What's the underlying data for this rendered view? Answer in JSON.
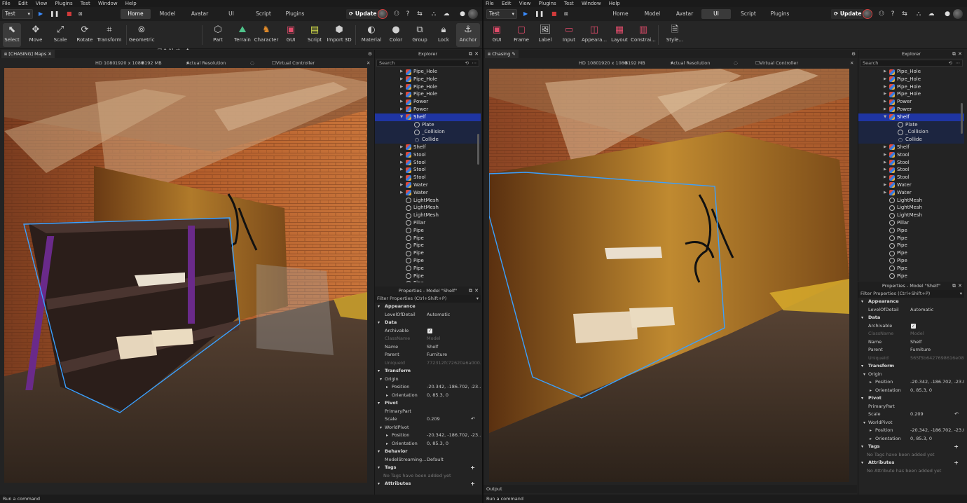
{
  "left": {
    "menu": [
      "File",
      "Edit",
      "View",
      "Plugins",
      "Test",
      "Window",
      "Help"
    ],
    "mode_dropdown": "Test",
    "tabs": [
      "Home",
      "Model",
      "Avatar",
      "UI",
      "Script",
      "Plugins"
    ],
    "active_tab": "Home",
    "update_label": "Update",
    "tools": [
      {
        "label": "Select",
        "icon": "cursor-icon"
      },
      {
        "label": "Move",
        "icon": "move-icon"
      },
      {
        "label": "Scale",
        "icon": "scale-icon"
      },
      {
        "label": "Rotate",
        "icon": "rotate-icon"
      },
      {
        "label": "Transform",
        "icon": "transform-icon"
      },
      {
        "label": "Geometric",
        "icon": "geometric-icon"
      },
      {
        "label": "Part",
        "icon": "cube-icon"
      },
      {
        "label": "Terrain",
        "icon": "terrain-icon"
      },
      {
        "label": "Character",
        "icon": "character-icon"
      },
      {
        "label": "GUI",
        "icon": "gui-icon"
      },
      {
        "label": "Script",
        "icon": "script-icon"
      },
      {
        "label": "Import 3D",
        "icon": "import-icon"
      },
      {
        "label": "Material",
        "icon": "material-icon"
      },
      {
        "label": "Color",
        "icon": "color-icon"
      },
      {
        "label": "Group",
        "icon": "group-icon"
      },
      {
        "label": "Lock",
        "icon": "lock-icon"
      },
      {
        "label": "Anchor",
        "icon": "anchor-icon"
      }
    ],
    "snap_move": "01 st...",
    "snap_rotate": "1°",
    "doc_tab": "[CHASING] Maps",
    "viewport_bar": {
      "preset": "HD 1080",
      "resolution": "1920 x 1080",
      "memory": "8192 MB",
      "mode": "Actual Resolution",
      "virtual": "Virtual Controller"
    },
    "command_placeholder": "Run a command"
  },
  "right": {
    "menu": [
      "File",
      "Edit",
      "View",
      "Plugins",
      "Test",
      "Window",
      "Help"
    ],
    "mode_dropdown": "Test",
    "tabs": [
      "Home",
      "Model",
      "Avatar",
      "UI",
      "Script",
      "Plugins"
    ],
    "active_tab": "UI",
    "update_label": "Update",
    "tools": [
      {
        "label": "GUI",
        "icon": "gui-icon"
      },
      {
        "label": "Frame",
        "icon": "frame-icon"
      },
      {
        "label": "Label",
        "icon": "label-icon"
      },
      {
        "label": "Input",
        "icon": "input-icon"
      },
      {
        "label": "Appeara...",
        "icon": "appearance-icon"
      },
      {
        "label": "Layout",
        "icon": "layout-icon"
      },
      {
        "label": "Constrai...",
        "icon": "constraint-icon"
      },
      {
        "label": "Style...",
        "icon": "style-icon"
      }
    ],
    "doc_tab": "Chasing",
    "viewport_bar": {
      "preset": "HD 1080",
      "resolution": "1920 x 1080",
      "memory": "8192 MB",
      "mode": "Actual Resolution",
      "virtual": "Virtual Controller"
    },
    "output_label": "Output",
    "command_placeholder": "Run a command"
  },
  "explorer": {
    "title": "Explorer",
    "search_placeholder": "Search",
    "items_left": [
      {
        "label": "Pipe_Hole",
        "type": "model",
        "depth": 0
      },
      {
        "label": "Pipe_Hole",
        "type": "model",
        "depth": 0
      },
      {
        "label": "Pipe_Hole",
        "type": "model",
        "depth": 0
      },
      {
        "label": "Pipe_Hole",
        "type": "model",
        "depth": 0
      },
      {
        "label": "Power",
        "type": "model",
        "depth": 0
      },
      {
        "label": "Power",
        "type": "model",
        "depth": 0
      },
      {
        "label": "Shelf",
        "type": "model",
        "depth": 0,
        "selected": true,
        "expanded": true
      },
      {
        "label": "Plate",
        "type": "mesh",
        "depth": 1
      },
      {
        "label": "_Collision",
        "type": "mesh",
        "depth": 1
      },
      {
        "label": "Collide",
        "type": "part",
        "depth": 1
      },
      {
        "label": "Shelf",
        "type": "model",
        "depth": 0
      },
      {
        "label": "Stool",
        "type": "model",
        "depth": 0
      },
      {
        "label": "Stool",
        "type": "model",
        "depth": 0
      },
      {
        "label": "Stool",
        "type": "model",
        "depth": 0
      },
      {
        "label": "Stool",
        "type": "model",
        "depth": 0
      },
      {
        "label": "Water",
        "type": "model",
        "depth": 0
      },
      {
        "label": "Water",
        "type": "model",
        "depth": 0
      },
      {
        "label": "LightMesh",
        "type": "mesh",
        "depth": 0
      },
      {
        "label": "LightMesh",
        "type": "mesh",
        "depth": 0
      },
      {
        "label": "LightMesh",
        "type": "mesh",
        "depth": 0
      },
      {
        "label": "Pillar",
        "type": "mesh",
        "depth": 0
      },
      {
        "label": "Pipe",
        "type": "mesh",
        "depth": 0
      },
      {
        "label": "Pipe",
        "type": "mesh",
        "depth": 0
      },
      {
        "label": "Pipe",
        "type": "mesh",
        "depth": 0
      },
      {
        "label": "Pipe",
        "type": "mesh",
        "depth": 0
      },
      {
        "label": "Pipe",
        "type": "mesh",
        "depth": 0
      },
      {
        "label": "Pipe",
        "type": "mesh",
        "depth": 0
      },
      {
        "label": "Pipe",
        "type": "mesh",
        "depth": 0
      },
      {
        "label": "Pipe",
        "type": "mesh",
        "depth": 0
      }
    ],
    "items_right": [
      {
        "label": "Pipe_Hole",
        "type": "model",
        "depth": 0
      },
      {
        "label": "Pipe_Hole",
        "type": "model",
        "depth": 0
      },
      {
        "label": "Pipe_Hole",
        "type": "model",
        "depth": 0
      },
      {
        "label": "Pipe_Hole",
        "type": "model",
        "depth": 0
      },
      {
        "label": "Power",
        "type": "model",
        "depth": 0
      },
      {
        "label": "Power",
        "type": "model",
        "depth": 0
      },
      {
        "label": "Shelf",
        "type": "model",
        "depth": 0,
        "selected": true,
        "expanded": true
      },
      {
        "label": "Plate",
        "type": "mesh",
        "depth": 1
      },
      {
        "label": "_Collision",
        "type": "mesh",
        "depth": 1
      },
      {
        "label": "Collide",
        "type": "part",
        "depth": 1
      },
      {
        "label": "Shelf",
        "type": "model",
        "depth": 0
      },
      {
        "label": "Stool",
        "type": "model",
        "depth": 0
      },
      {
        "label": "Stool",
        "type": "model",
        "depth": 0
      },
      {
        "label": "Stool",
        "type": "model",
        "depth": 0
      },
      {
        "label": "Stool",
        "type": "model",
        "depth": 0
      },
      {
        "label": "Water",
        "type": "model",
        "depth": 0
      },
      {
        "label": "Water",
        "type": "model",
        "depth": 0
      },
      {
        "label": "LightMesh",
        "type": "mesh",
        "depth": 0
      },
      {
        "label": "LightMesh",
        "type": "mesh",
        "depth": 0
      },
      {
        "label": "LightMesh",
        "type": "mesh",
        "depth": 0
      },
      {
        "label": "Pillar",
        "type": "mesh",
        "depth": 0
      },
      {
        "label": "Pipe",
        "type": "mesh",
        "depth": 0
      },
      {
        "label": "Pipe",
        "type": "mesh",
        "depth": 0
      },
      {
        "label": "Pipe",
        "type": "mesh",
        "depth": 0
      },
      {
        "label": "Pipe",
        "type": "mesh",
        "depth": 0
      },
      {
        "label": "Pipe",
        "type": "mesh",
        "depth": 0
      },
      {
        "label": "Pipe",
        "type": "mesh",
        "depth": 0
      },
      {
        "label": "Pipe",
        "type": "mesh",
        "depth": 0
      }
    ]
  },
  "properties": {
    "title": "Properties - Model \"Shelf\"",
    "filter_placeholder": "Filter Properties (Ctrl+Shift+P)",
    "rows_left": [
      {
        "kind": "cat",
        "label": "Appearance"
      },
      {
        "kind": "prop",
        "label": "LevelOfDetail",
        "value": "Automatic"
      },
      {
        "kind": "cat",
        "label": "Data"
      },
      {
        "kind": "check",
        "label": "Archivable",
        "value": "✓"
      },
      {
        "kind": "prop",
        "label": "ClassName",
        "value": "Model",
        "dim": true
      },
      {
        "kind": "prop",
        "label": "Name",
        "value": "Shelf"
      },
      {
        "kind": "prop",
        "label": "Parent",
        "value": "Furniture"
      },
      {
        "kind": "prop",
        "label": "UniqueId",
        "value": "772312fc72620a6a000...",
        "dim": true
      },
      {
        "kind": "cat",
        "label": "Transform"
      },
      {
        "kind": "group",
        "label": "Origin"
      },
      {
        "kind": "sub",
        "label": "Position",
        "value": "-20.342, -186.702, -23...."
      },
      {
        "kind": "sub",
        "label": "Orientation",
        "value": "0, 85.3, 0"
      },
      {
        "kind": "cat",
        "label": "Pivot"
      },
      {
        "kind": "prop",
        "label": "PrimaryPart",
        "value": ""
      },
      {
        "kind": "prop",
        "label": "Scale",
        "value": "0.209",
        "reset": true
      },
      {
        "kind": "group",
        "label": "WorldPivot"
      },
      {
        "kind": "sub",
        "label": "Position",
        "value": "-20.342, -186.702, -23...."
      },
      {
        "kind": "sub",
        "label": "Orientation",
        "value": "0, 85.3, 0"
      },
      {
        "kind": "cat",
        "label": "Behavior"
      },
      {
        "kind": "prop",
        "label": "ModelStreaming...",
        "value": "Default"
      },
      {
        "kind": "cat",
        "label": "Tags",
        "plus": true
      },
      {
        "kind": "note",
        "label": "No Tags have been added yet"
      },
      {
        "kind": "cat",
        "label": "Attributes",
        "plus": true
      }
    ],
    "rows_right": [
      {
        "kind": "cat",
        "label": "Appearance"
      },
      {
        "kind": "prop",
        "label": "LevelOfDetail",
        "value": "Automatic"
      },
      {
        "kind": "cat",
        "label": "Data"
      },
      {
        "kind": "check",
        "label": "Archivable",
        "value": "✓"
      },
      {
        "kind": "prop",
        "label": "ClassName",
        "value": "Model",
        "dim": true
      },
      {
        "kind": "prop",
        "label": "Name",
        "value": "Shelf"
      },
      {
        "kind": "prop",
        "label": "Parent",
        "value": "Furniture"
      },
      {
        "kind": "prop",
        "label": "UniqueId",
        "value": "565f5b6427698616e08e9...",
        "dim": true
      },
      {
        "kind": "cat",
        "label": "Transform"
      },
      {
        "kind": "group",
        "label": "Origin"
      },
      {
        "kind": "sub",
        "label": "Position",
        "value": "-20.342, -186.702, -23.073"
      },
      {
        "kind": "sub",
        "label": "Orientation",
        "value": "0, 85.3, 0"
      },
      {
        "kind": "cat",
        "label": "Pivot"
      },
      {
        "kind": "prop",
        "label": "PrimaryPart",
        "value": ""
      },
      {
        "kind": "prop",
        "label": "Scale",
        "value": "0.209",
        "reset": true
      },
      {
        "kind": "group",
        "label": "WorldPivot"
      },
      {
        "kind": "sub",
        "label": "Position",
        "value": "-20.342, -186.702, -23.073"
      },
      {
        "kind": "sub",
        "label": "Orientation",
        "value": "0, 85.3, 0"
      },
      {
        "kind": "cat",
        "label": "Tags",
        "plus": true
      },
      {
        "kind": "note",
        "label": "No Tags have been added yet"
      },
      {
        "kind": "cat",
        "label": "Attributes",
        "plus": true
      },
      {
        "kind": "note",
        "label": "No Attribute has been added yet"
      }
    ]
  },
  "colors": {
    "selection": "#1f35a3",
    "selection_outline": "#3aa0ff",
    "brick": "#8a4a26",
    "wood": "#8b5a1a"
  }
}
